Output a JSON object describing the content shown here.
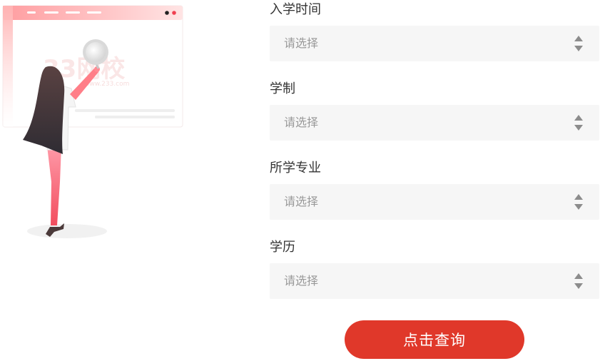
{
  "illustration": {
    "watermark": "33网校",
    "watermark_sub": "www.233.com"
  },
  "form": {
    "fields": [
      {
        "label": "入学时间",
        "placeholder": "请选择"
      },
      {
        "label": "学制",
        "placeholder": "请选择"
      },
      {
        "label": "所学专业",
        "placeholder": "请选择"
      },
      {
        "label": "学历",
        "placeholder": "请选择"
      }
    ],
    "submit_label": "点击查询"
  },
  "colors": {
    "accent": "#e0382a",
    "select_bg": "#f6f6f6",
    "placeholder": "#999999",
    "label": "#333333"
  },
  "icons": {
    "select_arrow": "sort-updown-icon"
  }
}
